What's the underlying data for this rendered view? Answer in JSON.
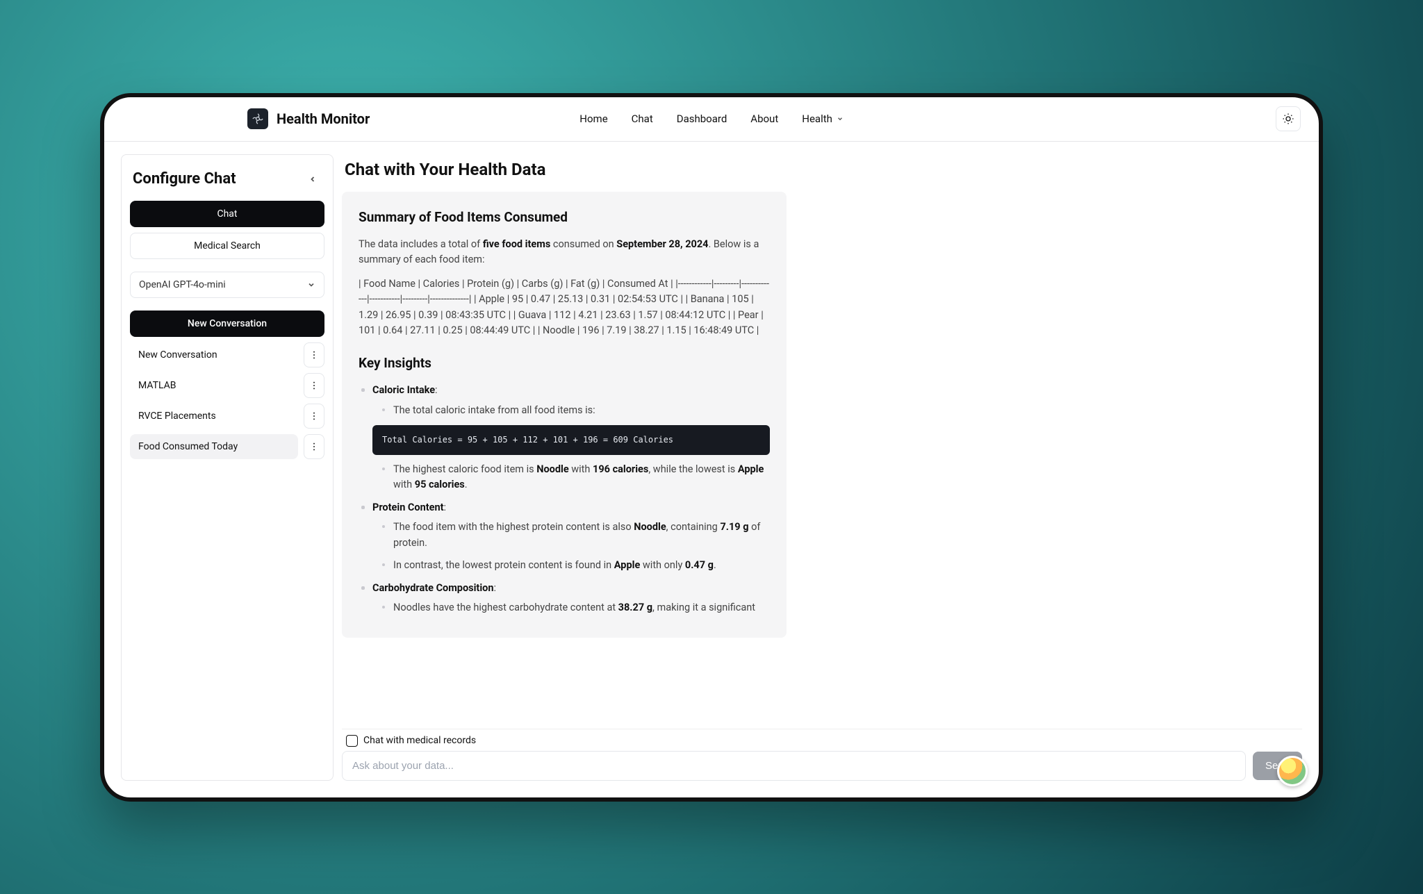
{
  "brand": {
    "title": "Health Monitor"
  },
  "nav": {
    "home": "Home",
    "chat": "Chat",
    "dashboard": "Dashboard",
    "about": "About",
    "health": "Health"
  },
  "sidebar": {
    "title": "Configure Chat",
    "tab_chat": "Chat",
    "tab_medical": "Medical Search",
    "model_selected": "OpenAI GPT-4o-mini",
    "new_conversation_btn": "New Conversation",
    "conversations": [
      {
        "label": "New Conversation",
        "active": false
      },
      {
        "label": "MATLAB",
        "active": false
      },
      {
        "label": "RVCE Placements",
        "active": false
      },
      {
        "label": "Food Consumed Today",
        "active": true
      }
    ]
  },
  "main": {
    "title": "Chat with Your Health Data",
    "checkbox_label": "Chat with medical records",
    "input_placeholder": "Ask about your data...",
    "send_label": "Send"
  },
  "message": {
    "summary_heading": "Summary of Food Items Consumed",
    "intro_pre": "The data includes a total of ",
    "intro_bold1": "five food items",
    "intro_mid": " consumed on ",
    "intro_bold2": "September 28, 2024",
    "intro_post": ". Below is a summary of each food item:",
    "table_blob": "| Food Name | Calories | Protein (g) | Carbs (g) | Fat (g) | Consumed At | |------------|---------|-------------|-----------|---------|--------------| | Apple | 95 | 0.47 | 25.13 | 0.31 | 02:54:53 UTC | | Banana | 105 | 1.29 | 26.95 | 0.39 | 08:43:35 UTC | | Guava | 112 | 4.21 | 23.63 | 1.57 | 08:44:12 UTC | | Pear | 101 | 0.64 | 27.11 | 0.25 | 08:44:49 UTC | | Noodle | 196 | 7.19 | 38.27 | 1.15 | 16:48:49 UTC |",
    "insights_heading": "Key Insights",
    "caloric_label": "Caloric Intake",
    "caloric_sub1": "The total caloric intake from all food items is:",
    "caloric_code": "Total Calories = 95 + 105 + 112 + 101 + 196 = 609 Calories",
    "caloric_sub2_pre": "The highest caloric food item is ",
    "caloric_sub2_b1": "Noodle",
    "caloric_sub2_mid1": " with ",
    "caloric_sub2_b2": "196 calories",
    "caloric_sub2_mid2": ", while the lowest is ",
    "caloric_sub2_b3": "Apple",
    "caloric_sub2_mid3": " with ",
    "caloric_sub2_b4": "95 calories",
    "caloric_sub2_post": ".",
    "protein_label": "Protein Content",
    "protein_sub1_pre": "The food item with the highest protein content is also ",
    "protein_sub1_b1": "Noodle",
    "protein_sub1_mid": ", containing ",
    "protein_sub1_b2": "7.19 g",
    "protein_sub1_post": " of protein.",
    "protein_sub2_pre": "In contrast, the lowest protein content is found in ",
    "protein_sub2_b1": "Apple",
    "protein_sub2_mid": " with only ",
    "protein_sub2_b2": "0.47 g",
    "protein_sub2_post": ".",
    "carb_label": "Carbohydrate Composition",
    "carb_sub1_pre": "Noodles have the highest carbohydrate content at ",
    "carb_sub1_b1": "38.27 g",
    "carb_sub1_post": ", making it a significant"
  }
}
